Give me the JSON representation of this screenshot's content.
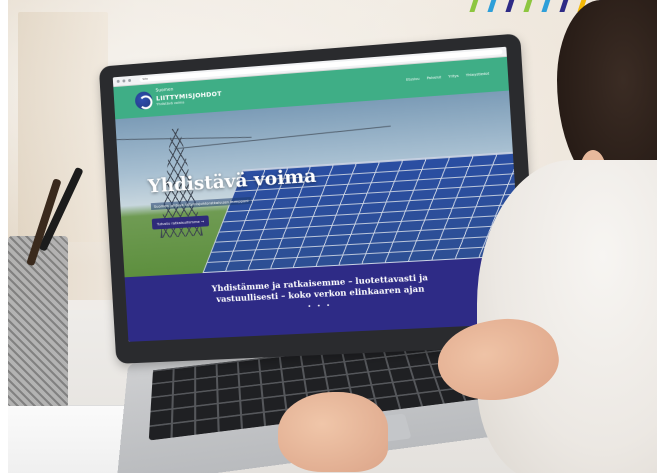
{
  "browser": {
    "url": "Site"
  },
  "site": {
    "logo": {
      "line1": "Suomen",
      "line2": "LIITTYMISJOHDOT",
      "line3": "Yhdistävä voima"
    },
    "nav": [
      "Etusivu",
      "Palvelut",
      "Yritys",
      "Yhteystiedot"
    ],
    "hero_title": "Yhdistävä voima",
    "hero_subtitle": "Suomen johtava liittymisjohtoratkaisujen kumppani",
    "hero_button": "Tutustu ratkaisuihimme",
    "band_line1": "Yhdistämme ja ratkaisemme – luotettavasti ja",
    "band_line2": "vastuullisesti – koko verkon elinkaaren ajan",
    "band_dots": "• • •"
  },
  "colors": {
    "header_green": "#3fae86",
    "band_purple": "#2e2b86",
    "accent_strip": [
      "#8dc63f",
      "#2e9fd9",
      "#2e2b86",
      "#f2b705"
    ]
  }
}
